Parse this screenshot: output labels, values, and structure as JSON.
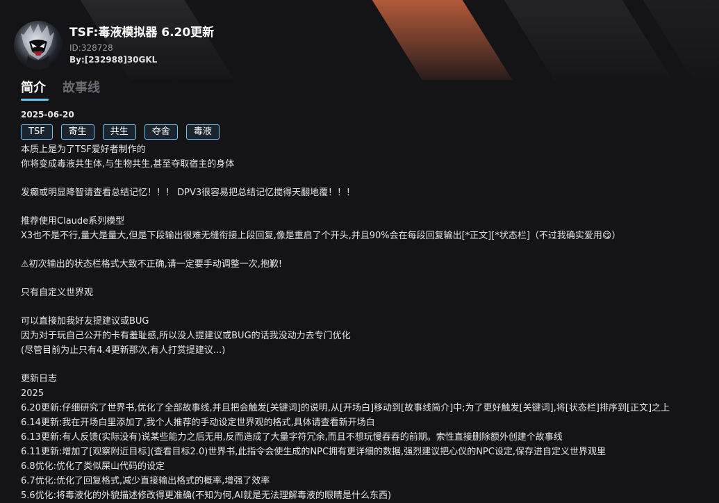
{
  "card": {
    "title": "TSF:毒液模拟器 6.20更新",
    "id_text": "ID:328728",
    "by_text": "By:[232988]30GKL"
  },
  "tabs": [
    {
      "label": "简介",
      "active": true
    },
    {
      "label": "故事线",
      "active": false
    }
  ],
  "date": "2025-06-20",
  "tags": [
    "TSF",
    "寄生",
    "共生",
    "夺舍",
    "毒液"
  ],
  "description": [
    "本质上是为了TSF爱好者制作的",
    "你将变成毒液共生体,与生物共生,甚至夺取宿主的身体",
    "",
    "发癫或明显降智请查看总结记忆！！！ DPV3很容易把总结记忆搅得天翻地覆！！！",
    "",
    "推荐使用Claude系列模型",
    "X3也不是不行,量大是量大,但是下段输出很难无缝衔接上段回复,像是重启了个开头,并且90%会在每段回复输出[*正文][*状态栏]（不过我确实爱用😋）",
    "",
    "⚠初次输出的状态栏格式大致不正确,请一定要手动调整一次,抱歉!",
    "",
    "只有自定义世界观",
    "",
    "可以直接加我好友提建议或BUG",
    "因为对于玩自己公开的卡有羞耻感,所以没人提建议或BUG的话我没动力去专门优化",
    "(尽管目前为止只有4.4更新那次,有人打赏提建议...)",
    "",
    "更新日志",
    "2025",
    "6.20更新:仔细研究了世界书,优化了全部故事线,并且把会触发[关键词]的说明,从[开场白]移动到[故事线简介]中;为了更好触发[关键词],将[状态栏]排序到[正文]之上",
    "6.14更新:我在开场白里添加了,我个人推荐的手动设定世界观的格式,具体请查看新开场白",
    "6.13更新:有人反馈(实际没有)说某些能力之后无用,反而造成了大量字符冗余,而且不想玩慢吞吞的前期。索性直接删除额外创建个故事线",
    "6.11更新:增加了[观察附近目标](查看目标2.0)世界书,此指令会使生成的NPC拥有更详细的数据,强烈建议把心仪的NPC设定,保存进自定义世界观里",
    "6.8优化:优化了类似屎山代码的设定",
    "6.7优化:优化了回复格式,减少直接输出格式的概率,增强了效率",
    "5.6优化:将毒液化的外貌描述修改得更准确(不知为何,AI就是无法理解毒液的眼睛是什么东西)"
  ],
  "colors": {
    "background": "#141417",
    "tab_accent": "#6cc3ee",
    "tag_border": "#74c6ee",
    "banner_orange": "#c9643f"
  },
  "icons": {
    "avatar": "venom-symbiote-avatar",
    "warning": "warning-icon"
  }
}
